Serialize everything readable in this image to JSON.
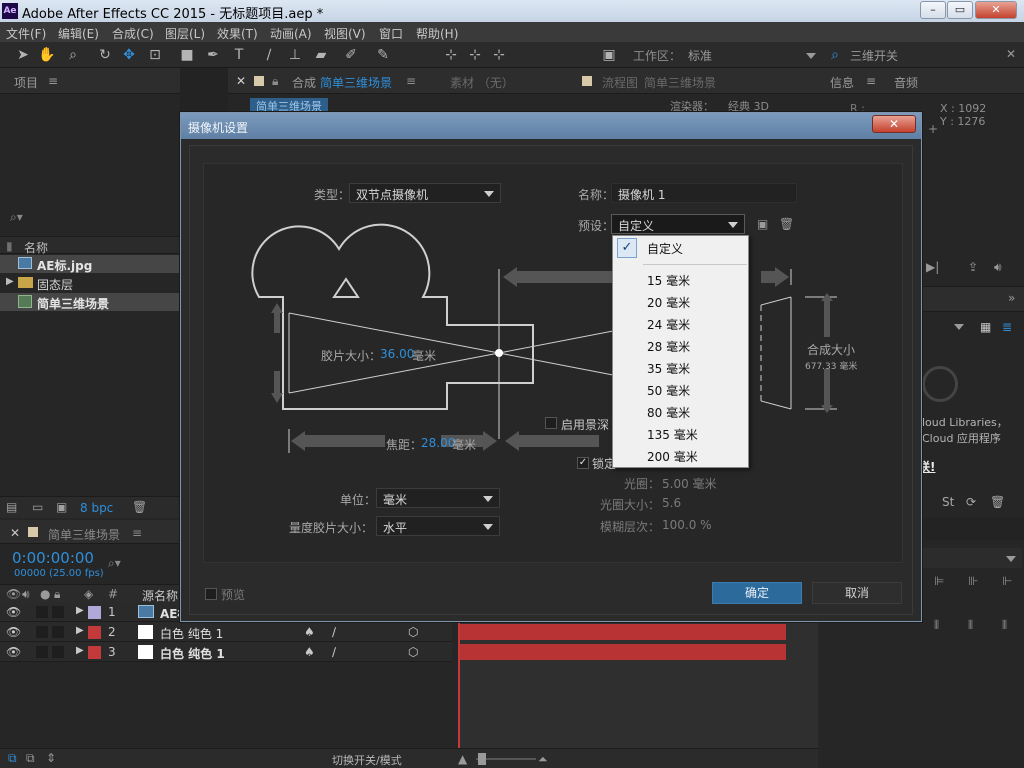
{
  "window": {
    "logo": "Ae",
    "title": "Adobe After Effects CC 2015 - 无标题项目.aep *",
    "min": "–",
    "max": "▭",
    "close": "✕"
  },
  "menu": [
    "文件(F)",
    "编辑(E)",
    "合成(C)",
    "图层(L)",
    "效果(T)",
    "动画(A)",
    "视图(V)",
    "窗口",
    "帮助(H)"
  ],
  "toolbar": {
    "workspace_label": "工作区：",
    "workspace_value": "标准",
    "search_value": "三维开关"
  },
  "project_panel": {
    "title": "项目",
    "name_header": "名称",
    "items": [
      "AE标.jpg",
      "固态层",
      "简单三维场景"
    ],
    "bpc": "8 bpc"
  },
  "comp_panel": {
    "tab_comp_prefix": "合成",
    "tab_comp_name": "简单三维场景",
    "tab_footage": "素材 （无）",
    "tab_flow_prefix": "流程图",
    "tab_flow_name": "简单三维场景",
    "sub_tab": "简单三维场景",
    "renderer_label": "渲染器：",
    "renderer_value": "经典 3D"
  },
  "info_panel": {
    "tab_info": "信息",
    "tab_audio": "音频",
    "r_label": "R :",
    "x_coord": "X : 1092",
    "y_coord": "Y : 1276"
  },
  "libraries_panel": {
    "line1": "loud Libraries，",
    "line2": "Cloud 应用程序",
    "line3": "联!"
  },
  "timeline": {
    "tab_name": "简单三维场景",
    "timecode": "0:00:00:00",
    "frames": "00000 (25.00 fps)",
    "source_name_header": "源名称",
    "layers": [
      {
        "num": "1",
        "name": "AE标.jpg",
        "color": "#b0a8d8"
      },
      {
        "num": "2",
        "name": "白色 纯色 1",
        "color": "#c43a3a"
      },
      {
        "num": "3",
        "name": "白色 纯色 1",
        "color": "#c43a3a"
      }
    ],
    "toggle_label": "切换开关/模式"
  },
  "dialog": {
    "title": "摄像机设置",
    "type_label": "类型：",
    "type_value": "双节点摄像机",
    "name_label": "名称：",
    "name_value": "摄像机 1",
    "preset_label": "预设：",
    "preset_value": "自定义",
    "film_size_label": "胶片大小：",
    "film_size_value": "36.00",
    "film_size_unit": "毫米",
    "comp_size_label": "合成大小",
    "comp_size_value": "677.33 毫米",
    "focal_label": "焦距：",
    "focal_value": "28.00",
    "focal_unit": "毫米",
    "enable_dof": "启用景深",
    "lock_label": "锁定",
    "aperture_label": "光圈：",
    "aperture_value": "5.00 毫米",
    "fstop_label": "光圈大小：",
    "fstop_value": "5.6",
    "blur_label": "模糊层次：",
    "blur_value": "100.0 %",
    "units_label": "单位：",
    "units_value": "毫米",
    "measure_label": "量度胶片大小：",
    "measure_value": "水平",
    "preview_label": "预览",
    "ok": "确定",
    "cancel": "取消",
    "check_mark": "✓",
    "preset_options": [
      "自定义",
      "15 毫米",
      "20 毫米",
      "24 毫米",
      "28 毫米",
      "35 毫米",
      "50 毫米",
      "80 毫米",
      "135 毫米",
      "200 毫米"
    ]
  }
}
